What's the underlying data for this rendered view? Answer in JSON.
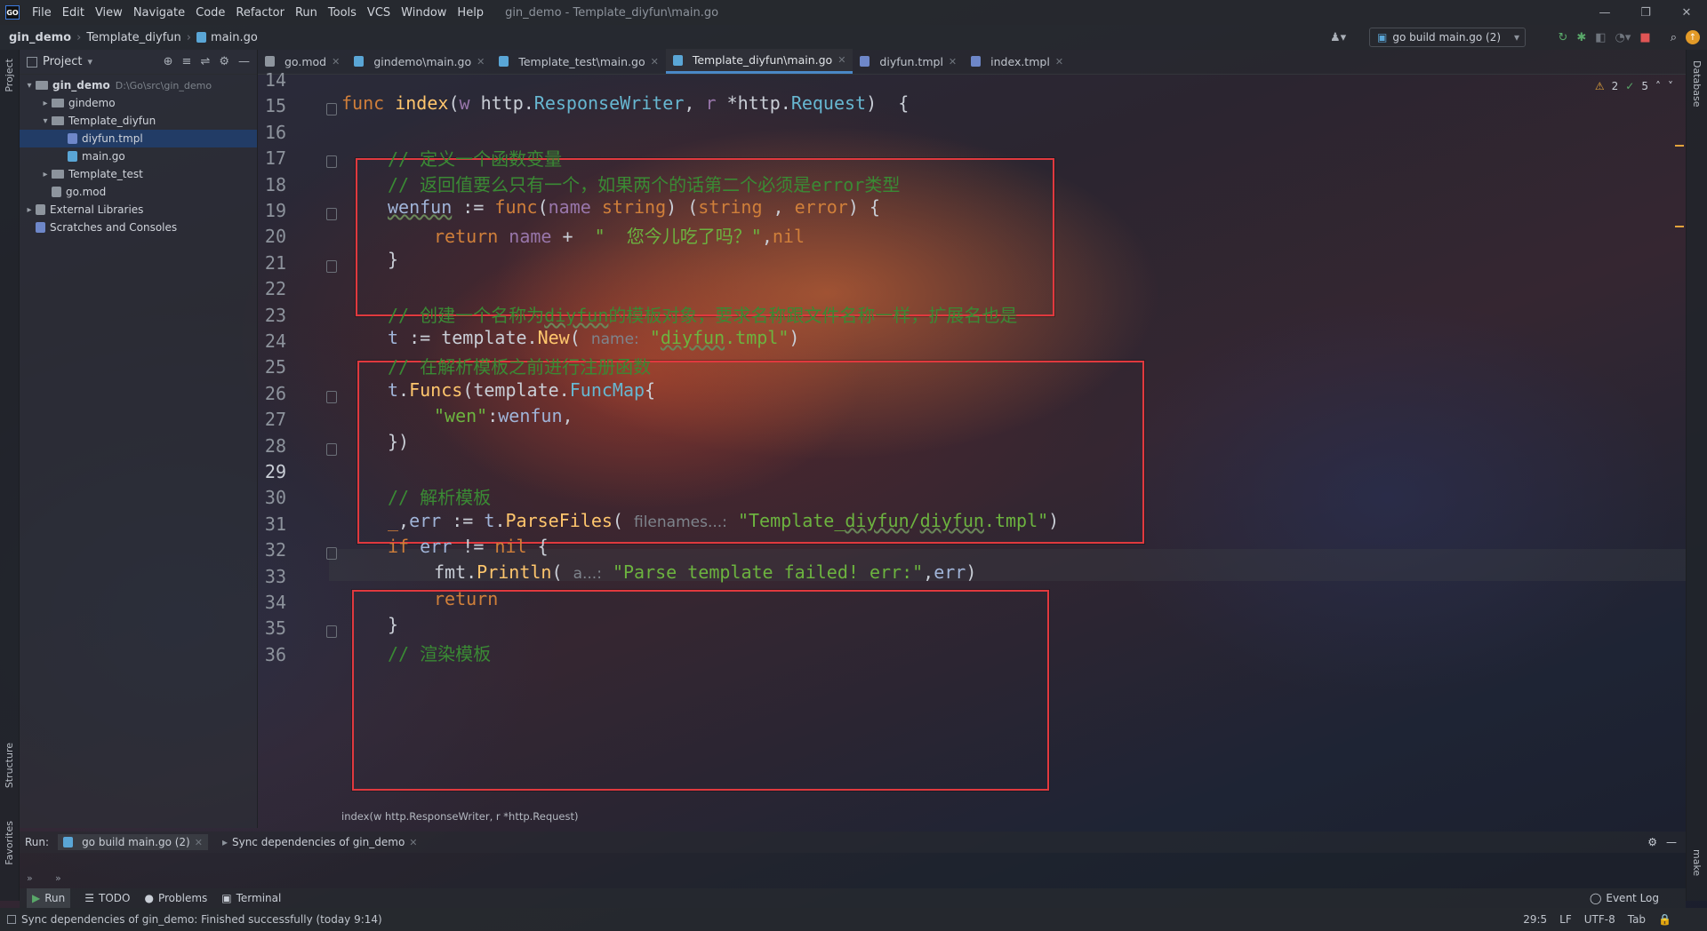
{
  "titlebar": {
    "logo": "GO",
    "menu": [
      "File",
      "Edit",
      "View",
      "Navigate",
      "Code",
      "Refactor",
      "Run",
      "Tools",
      "VCS",
      "Window",
      "Help"
    ],
    "title": "gin_demo - Template_diyfun\\main.go",
    "controls": [
      "—",
      "❐",
      "✕"
    ]
  },
  "navbar": {
    "crumbs": [
      "gin_demo",
      "Template_diyfun",
      "main.go"
    ],
    "run_config": "go build main.go (2)"
  },
  "project": {
    "title": "Project",
    "tree": [
      {
        "label": "gin_demo",
        "hint": "D:\\Go\\src\\gin_demo",
        "kind": "folder",
        "depth": 0,
        "open": true
      },
      {
        "label": "gindemo",
        "kind": "folder",
        "depth": 1,
        "open": false
      },
      {
        "label": "Template_diyfun",
        "kind": "folder",
        "depth": 1,
        "open": true
      },
      {
        "label": "diyfun.tmpl",
        "kind": "tpl",
        "depth": 2,
        "selected": true
      },
      {
        "label": "main.go",
        "kind": "go",
        "depth": 2
      },
      {
        "label": "Template_test",
        "kind": "folder",
        "depth": 1,
        "open": false
      },
      {
        "label": "go.mod",
        "kind": "mod",
        "depth": 1
      },
      {
        "label": "External Libraries",
        "kind": "lib",
        "depth": 0,
        "open": false
      },
      {
        "label": "Scratches and Consoles",
        "kind": "scratch",
        "depth": 0
      }
    ]
  },
  "tabs": [
    {
      "label": "go.mod",
      "active": false
    },
    {
      "label": "gindemo\\main.go",
      "active": false
    },
    {
      "label": "Template_test\\main.go",
      "active": false
    },
    {
      "label": "Template_diyfun\\main.go",
      "active": true
    },
    {
      "label": "diyfun.tmpl",
      "active": false
    },
    {
      "label": "index.tmpl",
      "active": false
    }
  ],
  "inspections": {
    "warnings": "2",
    "weak": "5"
  },
  "editor": {
    "lines": [
      14,
      15,
      16,
      17,
      18,
      19,
      20,
      21,
      22,
      23,
      24,
      25,
      26,
      27,
      28,
      29,
      30,
      31,
      32,
      33,
      34,
      35,
      36
    ],
    "current_line": 29,
    "breadcrumb": "index(w http.ResponseWriter, r *http.Request)"
  },
  "run": {
    "label": "Run:",
    "tabs": [
      "go build main.go (2)",
      "Sync dependencies of gin_demo"
    ]
  },
  "bottom_tools": [
    "Run",
    "TODO",
    "Problems",
    "Terminal"
  ],
  "event_log": "Event Log",
  "status": {
    "message": "Sync dependencies of gin_demo: Finished successfully (today 9:14)",
    "position": "29:5",
    "line_sep": "LF",
    "encoding": "UTF-8",
    "indent": "Tab"
  },
  "side_labels": {
    "project": "Project",
    "structure": "Structure",
    "favorites": "Favorites",
    "database": "Database",
    "make": "make"
  }
}
